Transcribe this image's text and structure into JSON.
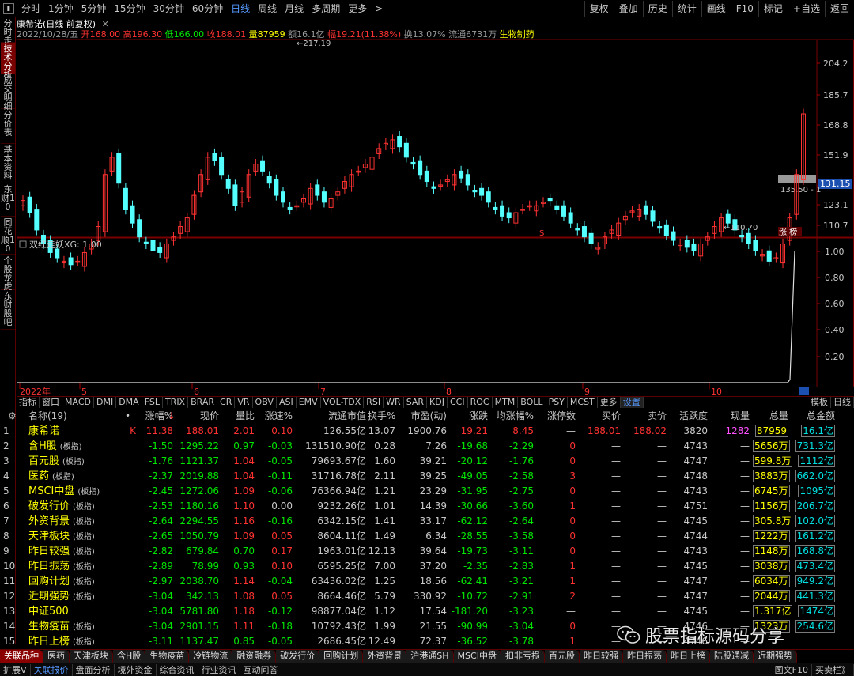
{
  "topbar": {
    "periods": [
      "分时",
      "1分钟",
      "5分钟",
      "15分钟",
      "30分钟",
      "60分钟",
      "日线",
      "周线",
      "月线",
      "多周期",
      "更多"
    ],
    "active_period": "日线",
    "buttons": [
      "复权",
      "叠加",
      "历史",
      "统计",
      "画线",
      "F10",
      "标记",
      "+自选",
      "返回"
    ]
  },
  "left_tabs": [
    "分时走势",
    "技术分析",
    "成交明细",
    "分价表",
    "基本资料",
    "东财10",
    "同花顺10",
    "个股龙虎",
    "东财股吧"
  ],
  "active_left_tab": "技术分析",
  "stock": {
    "name": "康希诺",
    "period_label": "(日线 前复权)",
    "date": "2022/10/28/五",
    "open_label": "开",
    "open": "168.00",
    "high_label": "高",
    "high": "196.30",
    "low_label": "低",
    "low": "166.00",
    "close_label": "收",
    "close": "188.01",
    "vol_label": "量",
    "vol": "87959",
    "amount_label": "额",
    "amount": "16.1亿",
    "change_label": "幅",
    "change": "19.21(11.38%)",
    "turnover_label": "换",
    "turnover": "13.07%",
    "float_label": "流通",
    "float": "6731万",
    "sector": "生物制药"
  },
  "price_axis": [
    "204.2",
    "185.7",
    "168.8",
    "151.9",
    "135.0",
    "123.1",
    "110.7"
  ],
  "current_price_tag": "131.15",
  "annotations": {
    "high_mark": "217.19",
    "low_mark": "110.70",
    "right_mark": "135.50",
    "zhang_bang": "涨 榜",
    "s_mark": "S"
  },
  "indicator": {
    "title": "双红走妖",
    "param": "XG: 1.00",
    "axis": [
      "1.00",
      "0.80",
      "0.60",
      "0.40",
      "0.20"
    ]
  },
  "x_axis": [
    "2022年",
    "5",
    "6",
    "7",
    "8",
    "9",
    "10"
  ],
  "indicator_tabs": [
    "指标",
    "窗口",
    "MACD",
    "DMI",
    "DMA",
    "FSL",
    "TRIX",
    "BRAR",
    "CR",
    "VR",
    "OBV",
    "ASI",
    "EMV",
    "VOL-TDX",
    "RSI",
    "WR",
    "SAR",
    "KDJ",
    "CCI",
    "ROC",
    "MTM",
    "BOLL",
    "PSY",
    "MCST",
    "更多",
    "设置"
  ],
  "indicator_right": [
    "模板",
    "日线"
  ],
  "table": {
    "headers": [
      "",
      "名称(19)",
      "",
      "涨幅%",
      "现价",
      "量比",
      "涨速%",
      "流通市值",
      "换手%",
      "市盈(动)",
      "涨跌",
      "均涨幅%",
      "涨停数",
      "买价",
      "卖价",
      "活跃度",
      "现量",
      "总量",
      "总金额"
    ],
    "rows": [
      {
        "idx": "1",
        "name": "康希诺",
        "tag": "",
        "flag": "K",
        "pct": "11.38",
        "price": "188.01",
        "vr": "2.01",
        "spd": "0.10",
        "mcap": "126.55亿",
        "turn": "13.07",
        "pe": "1900.76",
        "chg": "19.21",
        "avg": "8.45",
        "lim": "—",
        "bid": "188.01",
        "ask": "188.02",
        "act": "3820",
        "cur": "1282",
        "tot": "87959",
        "amt": "16.1亿"
      },
      {
        "idx": "2",
        "name": "含H股",
        "tag": "(板指)",
        "flag": "",
        "pct": "-1.50",
        "price": "1295.22",
        "vr": "0.97",
        "spd": "-0.03",
        "mcap": "131510.90亿",
        "turn": "0.28",
        "pe": "7.26",
        "chg": "-19.68",
        "avg": "-2.29",
        "lim": "0",
        "bid": "—",
        "ask": "—",
        "act": "4743",
        "cur": "—",
        "tot": "5656万",
        "amt": "731.3亿"
      },
      {
        "idx": "3",
        "name": "百元股",
        "tag": "(板指)",
        "flag": "",
        "pct": "-1.76",
        "price": "1121.37",
        "vr": "1.04",
        "spd": "-0.05",
        "mcap": "79693.67亿",
        "turn": "1.60",
        "pe": "39.21",
        "chg": "-20.12",
        "avg": "-1.76",
        "lim": "0",
        "bid": "—",
        "ask": "—",
        "act": "4747",
        "cur": "—",
        "tot": "599.8万",
        "amt": "1112亿"
      },
      {
        "idx": "4",
        "name": "医药",
        "tag": "(板指)",
        "flag": "",
        "pct": "-2.37",
        "price": "2019.88",
        "vr": "1.04",
        "spd": "-0.11",
        "mcap": "31716.78亿",
        "turn": "2.11",
        "pe": "39.25",
        "chg": "-49.05",
        "avg": "-2.58",
        "lim": "3",
        "bid": "—",
        "ask": "—",
        "act": "4748",
        "cur": "—",
        "tot": "3883万",
        "amt": "662.0亿"
      },
      {
        "idx": "5",
        "name": "MSCI中盘",
        "tag": "(板指)",
        "flag": "",
        "pct": "-2.45",
        "price": "1272.06",
        "vr": "1.09",
        "spd": "-0.06",
        "mcap": "76366.94亿",
        "turn": "1.21",
        "pe": "23.29",
        "chg": "-31.95",
        "avg": "-2.75",
        "lim": "0",
        "bid": "—",
        "ask": "—",
        "act": "4743",
        "cur": "—",
        "tot": "6745万",
        "amt": "1095亿"
      },
      {
        "idx": "6",
        "name": "破发行价",
        "tag": "(板指)",
        "flag": "",
        "pct": "-2.53",
        "price": "1180.16",
        "vr": "1.10",
        "spd": "0.00",
        "mcap": "9232.26亿",
        "turn": "1.01",
        "pe": "14.39",
        "chg": "-30.66",
        "avg": "-3.60",
        "lim": "1",
        "bid": "—",
        "ask": "—",
        "act": "4751",
        "cur": "—",
        "tot": "1156万",
        "amt": "206.7亿"
      },
      {
        "idx": "7",
        "name": "外资背景",
        "tag": "(板指)",
        "flag": "",
        "pct": "-2.64",
        "price": "2294.55",
        "vr": "1.16",
        "spd": "-0.16",
        "mcap": "6342.15亿",
        "turn": "1.41",
        "pe": "33.17",
        "chg": "-62.12",
        "avg": "-2.64",
        "lim": "0",
        "bid": "—",
        "ask": "—",
        "act": "4745",
        "cur": "—",
        "tot": "305.8万",
        "amt": "102.0亿"
      },
      {
        "idx": "8",
        "name": "天津板块",
        "tag": "(板指)",
        "flag": "",
        "pct": "-2.65",
        "price": "1050.79",
        "vr": "1.09",
        "spd": "0.05",
        "mcap": "8604.11亿",
        "turn": "1.49",
        "pe": "6.34",
        "chg": "-28.55",
        "avg": "-3.58",
        "lim": "0",
        "bid": "—",
        "ask": "—",
        "act": "4744",
        "cur": "—",
        "tot": "1222万",
        "amt": "161.2亿"
      },
      {
        "idx": "9",
        "name": "昨日较强",
        "tag": "(板指)",
        "flag": "",
        "pct": "-2.82",
        "price": "679.84",
        "vr": "0.70",
        "spd": "0.17",
        "mcap": "1963.01亿",
        "turn": "12.13",
        "pe": "39.64",
        "chg": "-19.73",
        "avg": "-3.11",
        "lim": "0",
        "bid": "—",
        "ask": "—",
        "act": "4743",
        "cur": "—",
        "tot": "1148万",
        "amt": "168.8亿"
      },
      {
        "idx": "10",
        "name": "昨日振荡",
        "tag": "(板指)",
        "flag": "",
        "pct": "-2.89",
        "price": "78.99",
        "vr": "0.93",
        "spd": "0.10",
        "mcap": "6595.25亿",
        "turn": "7.00",
        "pe": "37.20",
        "chg": "-2.35",
        "avg": "-2.83",
        "lim": "1",
        "bid": "—",
        "ask": "—",
        "act": "4745",
        "cur": "—",
        "tot": "3038万",
        "amt": "473.4亿"
      },
      {
        "idx": "11",
        "name": "回购计划",
        "tag": "(板指)",
        "flag": "",
        "pct": "-2.97",
        "price": "2038.70",
        "vr": "1.14",
        "spd": "-0.04",
        "mcap": "63436.02亿",
        "turn": "1.25",
        "pe": "18.56",
        "chg": "-62.41",
        "avg": "-3.21",
        "lim": "1",
        "bid": "—",
        "ask": "—",
        "act": "4747",
        "cur": "—",
        "tot": "6034万",
        "amt": "949.2亿"
      },
      {
        "idx": "12",
        "name": "近期强势",
        "tag": "(板指)",
        "flag": "",
        "pct": "-3.04",
        "price": "342.13",
        "vr": "1.08",
        "spd": "0.05",
        "mcap": "8664.46亿",
        "turn": "5.79",
        "pe": "330.92",
        "chg": "-10.72",
        "avg": "-2.91",
        "lim": "2",
        "bid": "—",
        "ask": "—",
        "act": "4747",
        "cur": "—",
        "tot": "2044万",
        "amt": "441.3亿"
      },
      {
        "idx": "13",
        "name": "中证500",
        "tag": "",
        "flag": "",
        "pct": "-3.04",
        "price": "5781.80",
        "vr": "1.18",
        "spd": "-0.12",
        "mcap": "98877.04亿",
        "turn": "1.12",
        "pe": "17.54",
        "chg": "-181.20",
        "avg": "-3.23",
        "lim": "—",
        "bid": "—",
        "ask": "—",
        "act": "4745",
        "cur": "—",
        "tot": "1.317亿",
        "amt": "1474亿"
      },
      {
        "idx": "14",
        "name": "生物疫苗",
        "tag": "(板指)",
        "flag": "",
        "pct": "-3.04",
        "price": "2901.15",
        "vr": "1.11",
        "spd": "-0.18",
        "mcap": "10792.43亿",
        "turn": "1.99",
        "pe": "21.55",
        "chg": "-90.99",
        "avg": "-3.04",
        "lim": "0",
        "bid": "—",
        "ask": "—",
        "act": "4746",
        "cur": "—",
        "tot": "1323万",
        "amt": "254.6亿"
      },
      {
        "idx": "15",
        "name": "昨日上榜",
        "tag": "(板指)",
        "flag": "",
        "pct": "-3.11",
        "price": "1137.47",
        "vr": "0.85",
        "spd": "-0.05",
        "mcap": "2686.45亿",
        "turn": "12.49",
        "pe": "72.37",
        "chg": "-36.52",
        "avg": "-3.78",
        "lim": "1",
        "bid": "—",
        "ask": "—",
        "act": "4746",
        "cur": "—",
        "tot": "",
        "amt": ""
      }
    ]
  },
  "section_tabs": [
    "关联品种",
    "医药",
    "天津板块",
    "含H股",
    "生物疫苗",
    "冷链物流",
    "融资融券",
    "破发行价",
    "回购计划",
    "外资背景",
    "沪港通SH",
    "MSCI中盘",
    "扣非亏损",
    "百元股",
    "昨日较强",
    "昨日振荡",
    "昨日上榜",
    "陆股通减",
    "近期强势"
  ],
  "status_bar": [
    "扩展V",
    "关联报价",
    "盘面分析",
    "境外资金",
    "综合资讯",
    "行业资讯",
    "互动问答"
  ],
  "status_right": [
    "图文F10",
    "买卖栏》"
  ],
  "watermark_text": "股票指标源码分享",
  "colors": {
    "up": "#ff3232",
    "down": "#00e600",
    "candle_down": "#54ffff",
    "name": "#ffff00",
    "accent": "#5599ff"
  }
}
